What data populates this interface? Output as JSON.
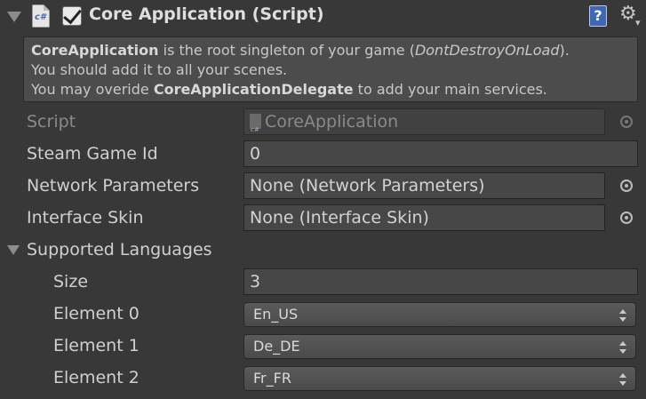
{
  "component": {
    "title": "Core Application (Script)",
    "enabled": true,
    "script_icon_text": "c#",
    "help_icon_text": "?",
    "gear_icon_text": "⚙"
  },
  "helpbox": {
    "line1_bold": "CoreApplication",
    "line1_text": " is the root singleton of your game (",
    "line1_italic": "DontDestroyOnLoad",
    "line1_end": ").",
    "line2": "You should add it to all your scenes.",
    "line3_start": "You may overide ",
    "line3_bold": "CoreApplicationDelegate",
    "line3_end": " to add your main services."
  },
  "fields": {
    "script": {
      "label": "Script",
      "value": "CoreApplication"
    },
    "steam_game_id": {
      "label": "Steam Game Id",
      "value": "0"
    },
    "network_parameters": {
      "label": "Network Parameters",
      "value": "None (Network Parameters)"
    },
    "interface_skin": {
      "label": "Interface Skin",
      "value": "None (Interface Skin)"
    }
  },
  "supported_languages": {
    "label": "Supported Languages",
    "expanded": true,
    "size_label": "Size",
    "size_value": "3",
    "elements": [
      {
        "label": "Element 0",
        "value": "En_US"
      },
      {
        "label": "Element 1",
        "value": "De_DE"
      },
      {
        "label": "Element 2",
        "value": "Fr_FR"
      }
    ]
  },
  "colors": {
    "background": "#383838",
    "helpbox": "#4c4c4c",
    "field": "#474747",
    "help_icon": "#3f67b5"
  }
}
